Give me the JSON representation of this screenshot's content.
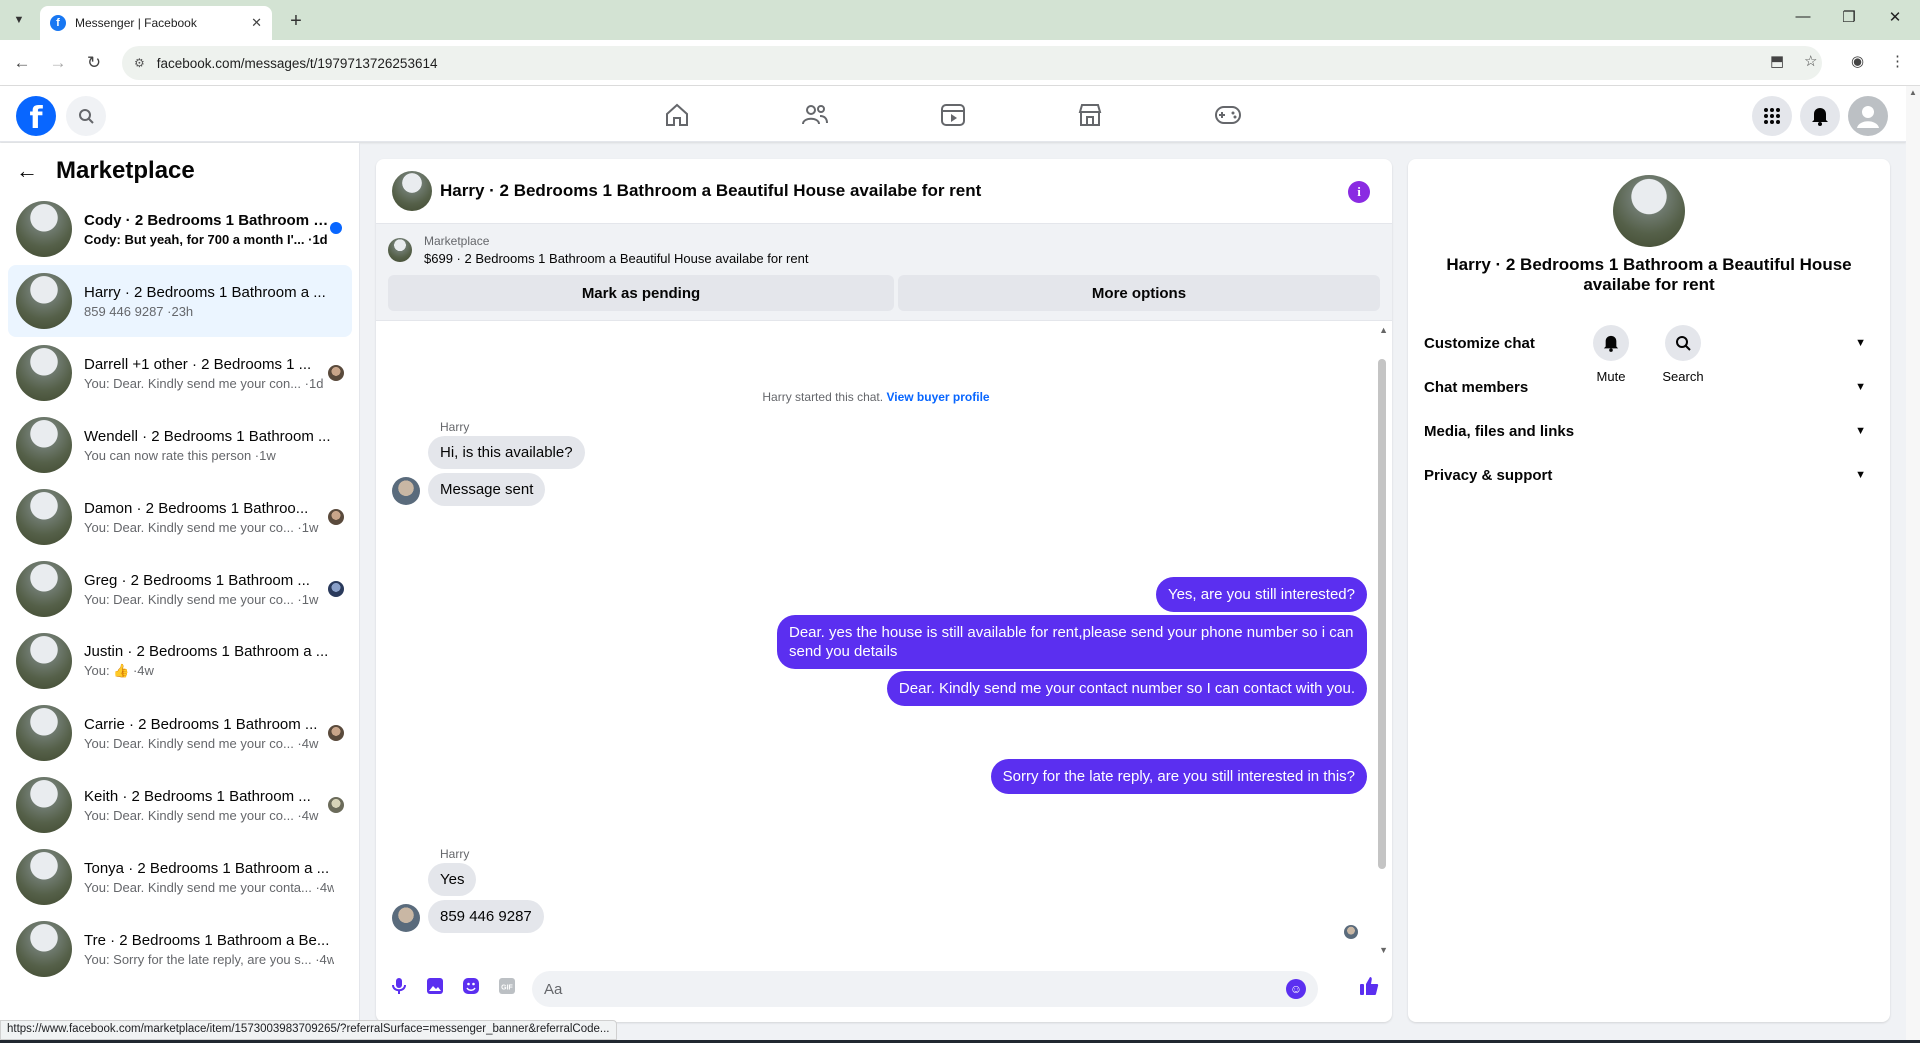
{
  "browser": {
    "tab_title": "Messenger | Facebook",
    "url": "facebook.com/messages/t/1979713726253614",
    "status_url": "https://www.facebook.com/marketplace/item/1573003983709265/?referralSurface=messenger_banner&referralCode..."
  },
  "sidebar": {
    "title": "Marketplace",
    "conversations": [
      {
        "name": "Cody · 2 Bedrooms 1 Bathroom a...",
        "preview": "Cody: But yeah, for 700 a month I'... ·1d",
        "unread": true
      },
      {
        "name": "Harry · 2 Bedrooms 1 Bathroom a ...",
        "preview": "859 446 9287 ·23h",
        "active": true
      },
      {
        "name": "Darrell +1 other · 2 Bedrooms 1 ...",
        "preview": "You: Dear. Kindly send me your con... ·1d"
      },
      {
        "name": "Wendell · 2 Bedrooms 1 Bathroom ...",
        "preview": "You can now rate this person ·1w"
      },
      {
        "name": "Damon · 2 Bedrooms 1 Bathroo...",
        "preview": "You: Dear. Kindly send me your co... ·1w"
      },
      {
        "name": "Greg · 2 Bedrooms 1 Bathroom ...",
        "preview": "You: Dear. Kindly send me your co... ·1w"
      },
      {
        "name": "Justin · 2 Bedrooms 1 Bathroom a ...",
        "preview": "You: 👍 ·4w"
      },
      {
        "name": "Carrie · 2 Bedrooms 1 Bathroom ...",
        "preview": "You: Dear. Kindly send me your co... ·4w"
      },
      {
        "name": "Keith · 2 Bedrooms 1 Bathroom ...",
        "preview": "You: Dear. Kindly send me your co... ·4w"
      },
      {
        "name": "Tonya · 2 Bedrooms 1 Bathroom a ...",
        "preview": "You: Dear. Kindly send me your conta... ·4w"
      },
      {
        "name": "Tre · 2 Bedrooms 1 Bathroom a Be...",
        "preview": "You: Sorry for the late reply, are you s... ·4w"
      }
    ]
  },
  "chat": {
    "title": "Harry · 2 Bedrooms 1 Bathroom a Beautiful House availabe for rent",
    "banner_label": "Marketplace",
    "banner_listing": "$699 · 2 Bedrooms 1 Bathroom a Beautiful House availabe for rent",
    "mark_pending": "Mark as pending",
    "more_options": "More options",
    "started_text": "Harry started this chat.",
    "view_profile": "View buyer profile",
    "sender": "Harry",
    "in_1": "Hi, is this available?",
    "in_2": "Message sent",
    "out_1": "Yes, are you still interested?",
    "out_2": "Dear. yes the house is still available for rent,please send your  phone number so i can send you details",
    "out_3": "Dear. Kindly send me your contact number so I can contact with you.",
    "out_4": "Sorry for the late reply, are you still interested in this?",
    "in_3": "Yes",
    "in_4": "859 446 9287",
    "composer_placeholder": "Aa",
    "accent": "#5b2ff0"
  },
  "details": {
    "title": "Harry · 2 Bedrooms 1 Bathroom a Beautiful House availabe for rent",
    "mute": "Mute",
    "search": "Search",
    "sections": [
      "Customize chat",
      "Chat members",
      "Media, files and links",
      "Privacy & support"
    ]
  }
}
